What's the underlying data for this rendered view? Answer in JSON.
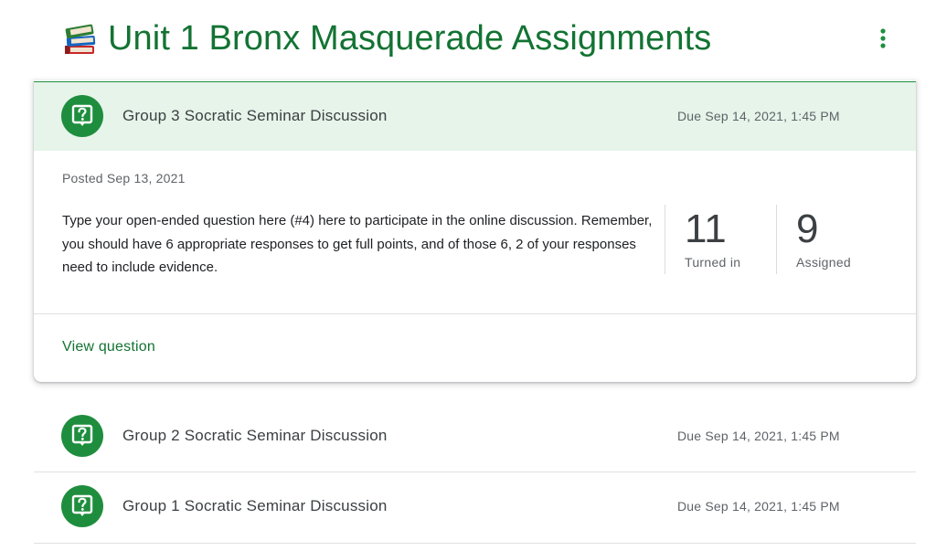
{
  "topic": {
    "title": "Unit 1 Bronx Masquerade Assignments",
    "icon": "books-emoji-icon"
  },
  "expanded_assignment": {
    "title": "Group 3 Socratic Seminar Discussion",
    "due": "Due Sep 14, 2021, 1:45 PM",
    "posted": "Posted Sep 13, 2021",
    "instructions": "Type your open-ended question here (#4) here to participate in the online discussion. Remember, you should have 6 appropriate responses to get full points, and of those 6, 2 of your responses need to include evidence.",
    "turned_in_count": "11",
    "turned_in_label": "Turned in",
    "assigned_count": "9",
    "assigned_label": "Assigned",
    "view_link": "View question",
    "icon": "question-icon"
  },
  "assignments": [
    {
      "title": "Group 2 Socratic Seminar Discussion",
      "due": "Due Sep 14, 2021, 1:45 PM",
      "icon": "question-icon"
    },
    {
      "title": "Group 1 Socratic Seminar Discussion",
      "due": "Due Sep 14, 2021, 1:45 PM",
      "icon": "question-icon"
    }
  ],
  "colors": {
    "accent": "#1e8e3e",
    "accent_text": "#137333",
    "header_bg": "#e6f4ea"
  }
}
